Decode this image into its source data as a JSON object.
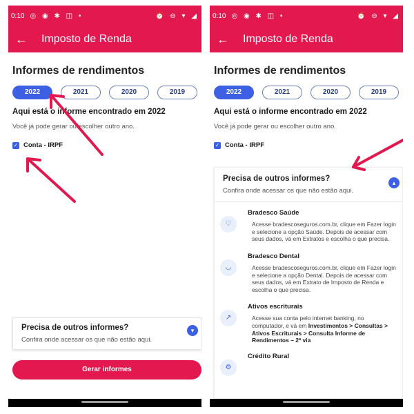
{
  "status": {
    "time": "0:10",
    "left_icons": "◎ ◉ ✱ ◫ •",
    "right_icons": "⏰ ⊖ ▾ ◢"
  },
  "app": {
    "title": "Imposto de Renda"
  },
  "heading": "Informes de rendimentos",
  "years": [
    "2022",
    "2021",
    "2020",
    "2019"
  ],
  "selected_year": "2022",
  "found_text": "Aqui está o informe encontrado em 2022",
  "sub_text": "Você já pode gerar ou escolher outro ano.",
  "checkbox_label": "Conta - IRPF",
  "other": {
    "title": "Precisa de outros informes?",
    "subtitle": "Confira onde acessar os que não estão aqui."
  },
  "generate_button": "Gerar informes",
  "entries": [
    {
      "title": "Bradesco Saúde",
      "desc": "Acesse bradescoseguros.com.br, clique em Fazer login e selecione a opção Saúde. Depois de acessar com seus dados, vá em Extratos e escolha o que precisa.",
      "icon": "heart-icon"
    },
    {
      "title": "Bradesco Dental",
      "desc": "Acesse bradescoseguros.com.br, clique em Fazer login e selecione a opção Dental. Depois de acessar com seus dados, vá em Extrato de Imposto de Renda e escolha o que precisa.",
      "icon": "tooth-icon"
    },
    {
      "title": "Ativos escriturais",
      "desc": "Acesse sua conta pelo internet banking, no computador, e vá em",
      "desc_bold": "Investimentos > Consultas > Ativos Escriturais > Consulta Informe de Rendimentos – 2ª via",
      "icon": "chart-icon"
    },
    {
      "title": "Crédito Rural",
      "desc": "",
      "icon": "tractor-icon"
    }
  ],
  "colors": {
    "brand": "#e3184f",
    "accent": "#3d5fe4",
    "annotation": "#e3184f"
  }
}
